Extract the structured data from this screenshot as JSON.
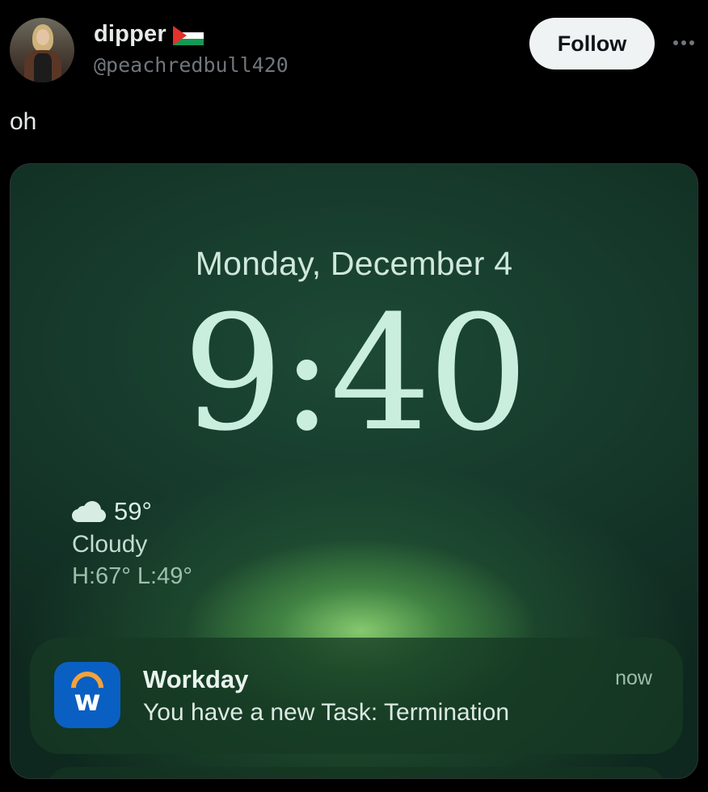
{
  "tweet": {
    "author": {
      "display_name": "dipper",
      "handle": "@peachredbull420",
      "flag_icon": "palestine-flag-icon"
    },
    "follow_label": "Follow",
    "more_icon": "more-horizontal-icon",
    "text": "oh"
  },
  "lock_screen": {
    "date": "Monday, December 4",
    "time": "9:40",
    "weather": {
      "icon": "cloud-icon",
      "temperature": "59°",
      "condition": "Cloudy",
      "high_low": "H:67° L:49°"
    },
    "notification": {
      "app_icon": "workday-icon",
      "app_icon_letter": "w",
      "app_name": "Workday",
      "message": "You have a new Task: Termination",
      "time": "now"
    }
  },
  "colors": {
    "background": "#000000",
    "follow_button_bg": "#eff3f4",
    "workday_blue": "#0a5fc2",
    "workday_orange": "#f4a23a",
    "lock_screen_green": "#1d4a35"
  }
}
